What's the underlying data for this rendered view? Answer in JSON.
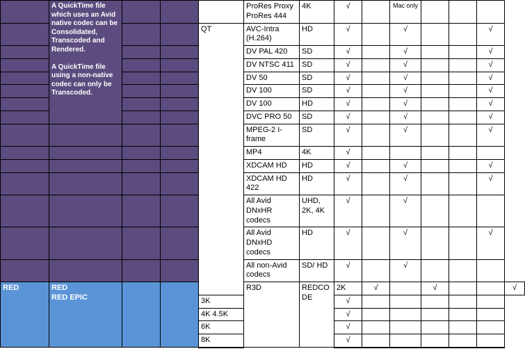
{
  "check": "√",
  "macOnly": "Mac only",
  "note1": "A QuickTime file which uses an Avid native codec can be Consolidated, Transcoded and Rendered.",
  "note2": "A QuickTime file using a non-native codec can only be Transcoded.",
  "qtWrapper": "QT",
  "qt": {
    "r0": {
      "codec": "ProRes Proxy ProRes 444",
      "res": "4K"
    },
    "r1": {
      "codec": "AVC-Intra (H.264)",
      "res": "HD"
    },
    "r2": {
      "codec": "DV PAL 420",
      "res": "SD"
    },
    "r3": {
      "codec": "DV NTSC 411",
      "res": "SD"
    },
    "r4": {
      "codec": "DV 50",
      "res": "SD"
    },
    "r5": {
      "codec": "DV 100",
      "res": "SD"
    },
    "r6": {
      "codec": "DV 100",
      "res": "HD"
    },
    "r7": {
      "codec": "DVC PRO 50",
      "res": "SD"
    },
    "r8": {
      "codec": "MPEG-2 I-frame",
      "res": "SD"
    },
    "r9": {
      "codec": "MP4",
      "res": "4K"
    },
    "r10": {
      "codec": "XDCAM HD",
      "res": "HD"
    },
    "r11": {
      "codec": "XDCAM HD 422",
      "res": "HD"
    },
    "r12": {
      "codec": "All Avid DNxHR codecs",
      "res": "UHD, 2K, 4K"
    },
    "r13": {
      "codec": "All Avid DNxHD codecs",
      "res": "HD"
    },
    "r14": {
      "codec": "All non-Avid codecs",
      "res": "SD/ HD"
    }
  },
  "red": {
    "vendor": "RED",
    "camera": "RED\nRED EPIC",
    "wrapper": "R3D",
    "codec": "REDCODE",
    "r0": {
      "res": "2K"
    },
    "r1": {
      "res": "3K"
    },
    "r2": {
      "res": "4K 4.5K"
    },
    "r3": {
      "res": "6K"
    },
    "r4": {
      "res": "8K"
    }
  }
}
